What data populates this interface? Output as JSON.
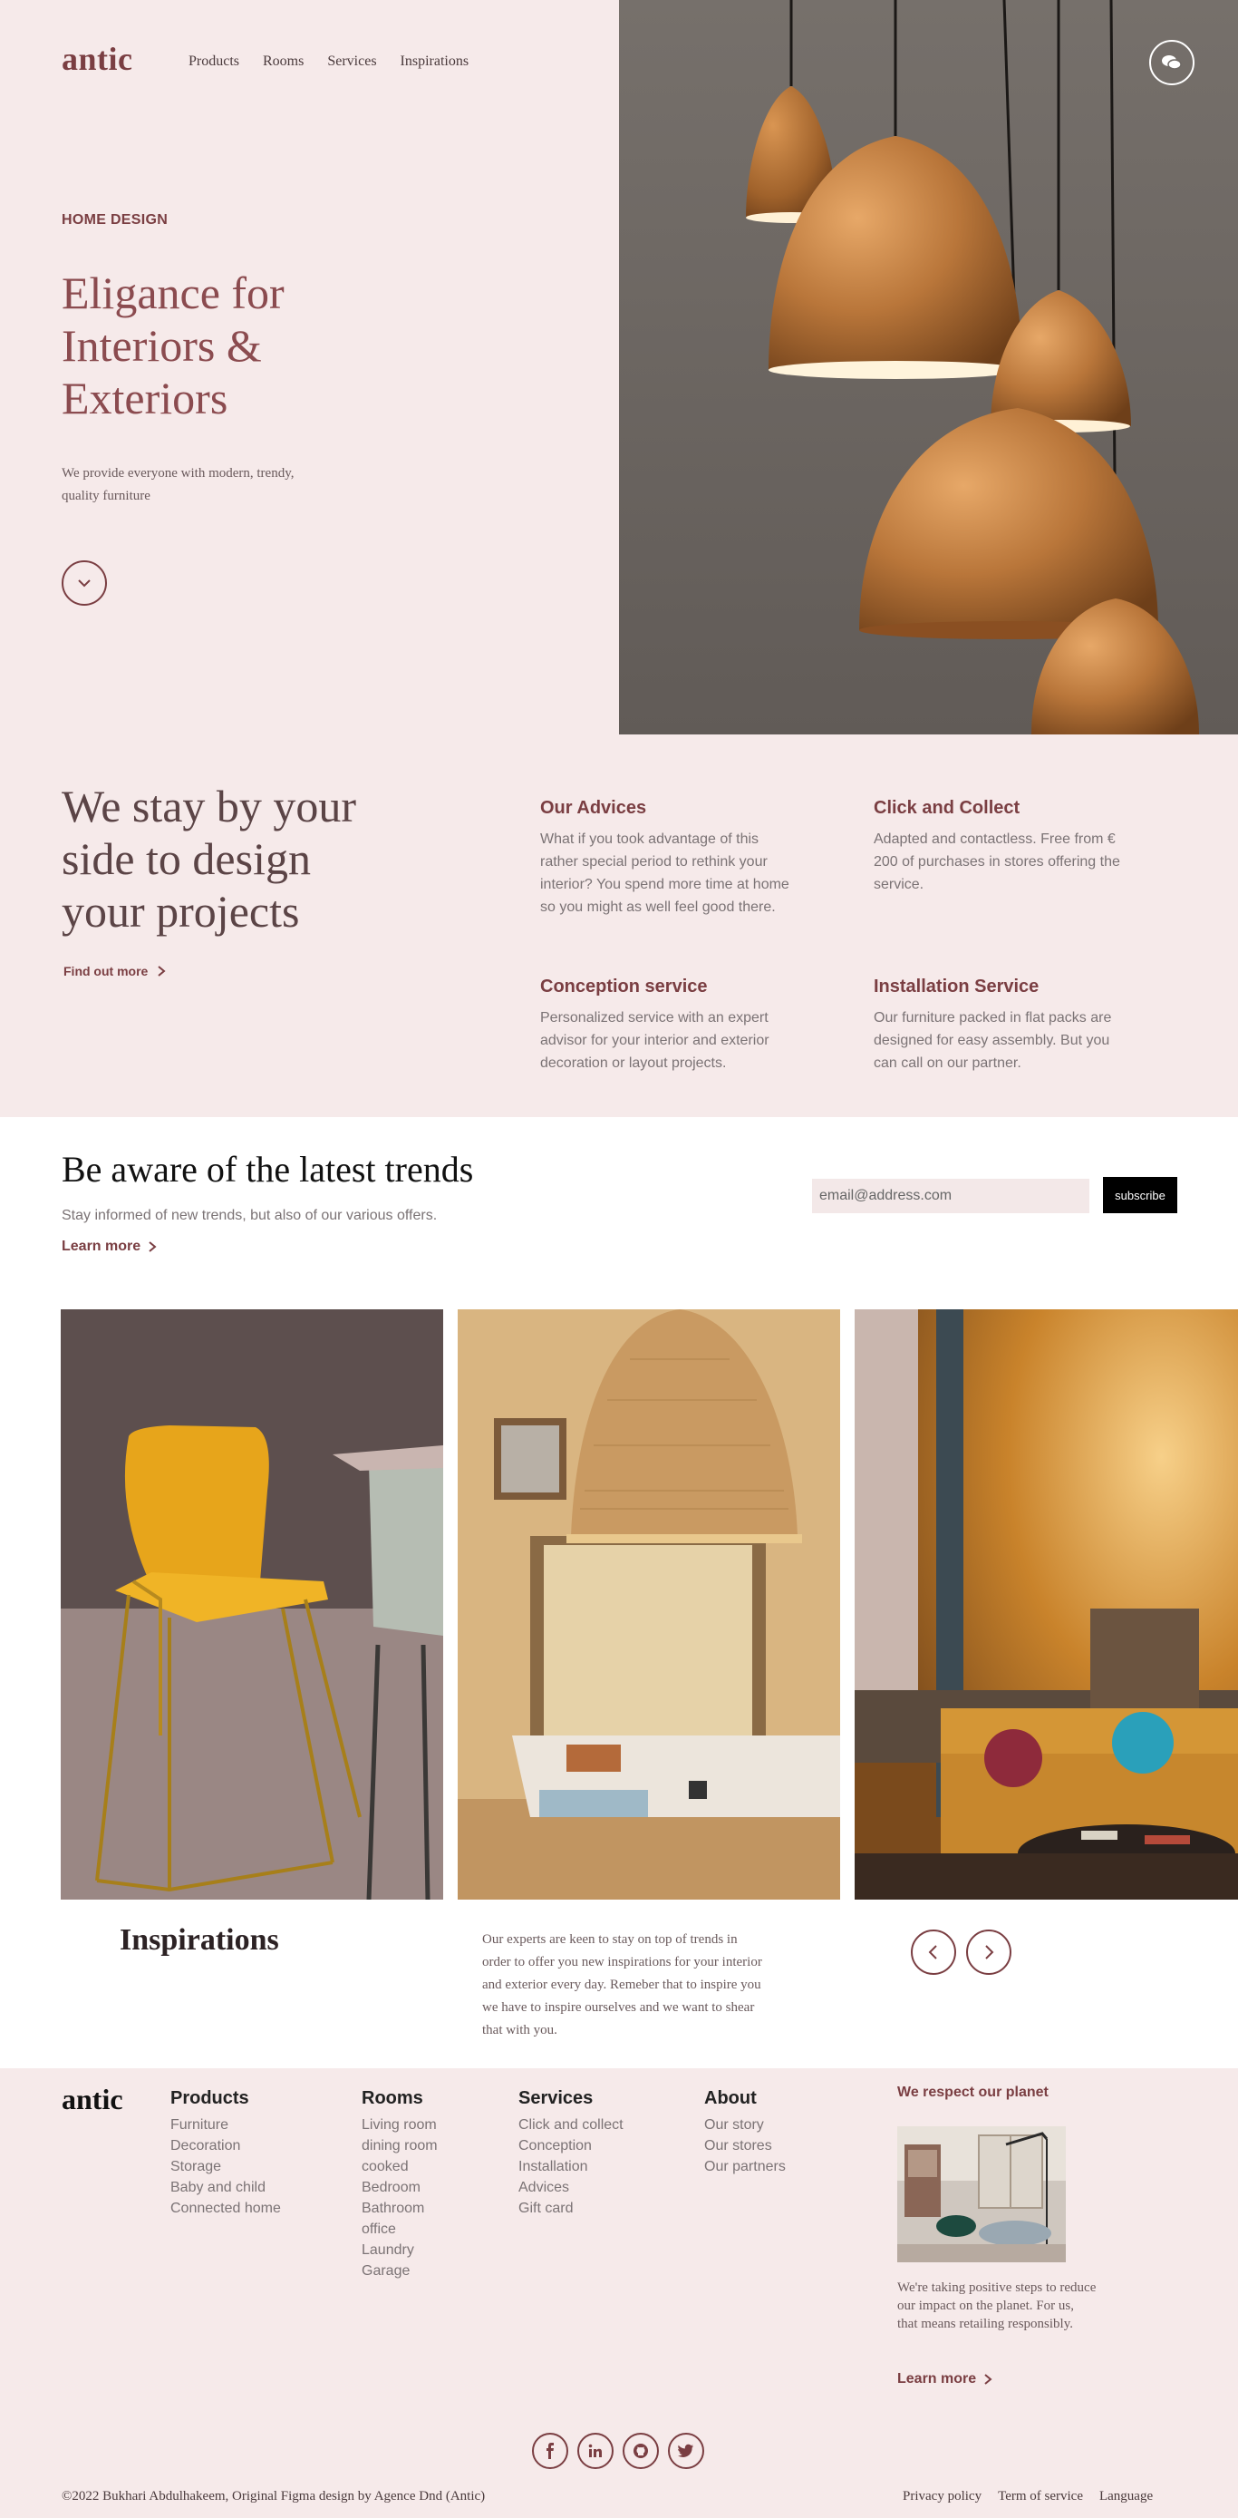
{
  "header": {
    "logo": "antic",
    "nav": [
      "Products",
      "Rooms",
      "Services",
      "Inspirations"
    ]
  },
  "hero": {
    "eyebrow": "HOME DESIGN",
    "title": "Eligance for Interiors & Exteriors",
    "subtitle": "We provide everyone with modern, trendy, quality furniture"
  },
  "services": {
    "title": "We stay by your side to design your projects",
    "link": "Find out more",
    "items": [
      {
        "title": "Our Advices",
        "text": "What if you took advantage of this rather special period to rethink your interior? You spend more time at home so you might as well feel good there."
      },
      {
        "title": "Click and Collect",
        "text": "Adapted and contactless. Free from € 200 of purchases in stores offering the service."
      },
      {
        "title": "Conception service",
        "text": "Personalized service with an expert advisor for your interior and exterior decoration or layout projects."
      },
      {
        "title": "Installation Service",
        "text": "Our furniture packed in flat packs are designed for easy assembly. But you can call on our partner."
      }
    ]
  },
  "newsletter": {
    "title": "Be aware of the latest trends",
    "subtitle": "Stay informed of new trends, but also of our various offers.",
    "link": "Learn more",
    "email_placeholder": "email@address.com",
    "button": "subscribe"
  },
  "inspirations": {
    "title": "Inspirations",
    "text": "Our experts are keen to stay on top of trends in order to offer you new inspirations for your interior and exterior every day. Remeber that to inspire you we have to inspire ourselves and we want to shear that with you."
  },
  "footer": {
    "logo": "antic",
    "columns": [
      {
        "title": "Products",
        "links": [
          "Furniture",
          "Decoration",
          "Storage",
          "Baby and child",
          "Connected home"
        ]
      },
      {
        "title": "Rooms",
        "links": [
          "Living room",
          "dining room",
          "cooked",
          "Bedroom",
          "Bathroom",
          "office",
          "Laundry",
          "Garage"
        ]
      },
      {
        "title": "Services",
        "links": [
          "Click and collect",
          "Conception",
          "Installation",
          "Advices",
          "Gift card"
        ]
      },
      {
        "title": "About",
        "links": [
          "Our story",
          "Our stores",
          "Our partners"
        ]
      }
    ],
    "planet": {
      "title": "We respect our planet",
      "text": "We're taking positive steps to reduce our impact on the planet. For us, that means retailing responsibly.",
      "link": "Learn more"
    },
    "copyright": "©2022 Bukhari Abdulhakeem, Original Figma design by Agence Dnd (Antic)",
    "legal": [
      "Privacy policy",
      "Term of service",
      "Language"
    ]
  },
  "colors": {
    "accent": "#7a3e42",
    "background_pink": "#f6eaea",
    "copper": "#c27a3c"
  }
}
